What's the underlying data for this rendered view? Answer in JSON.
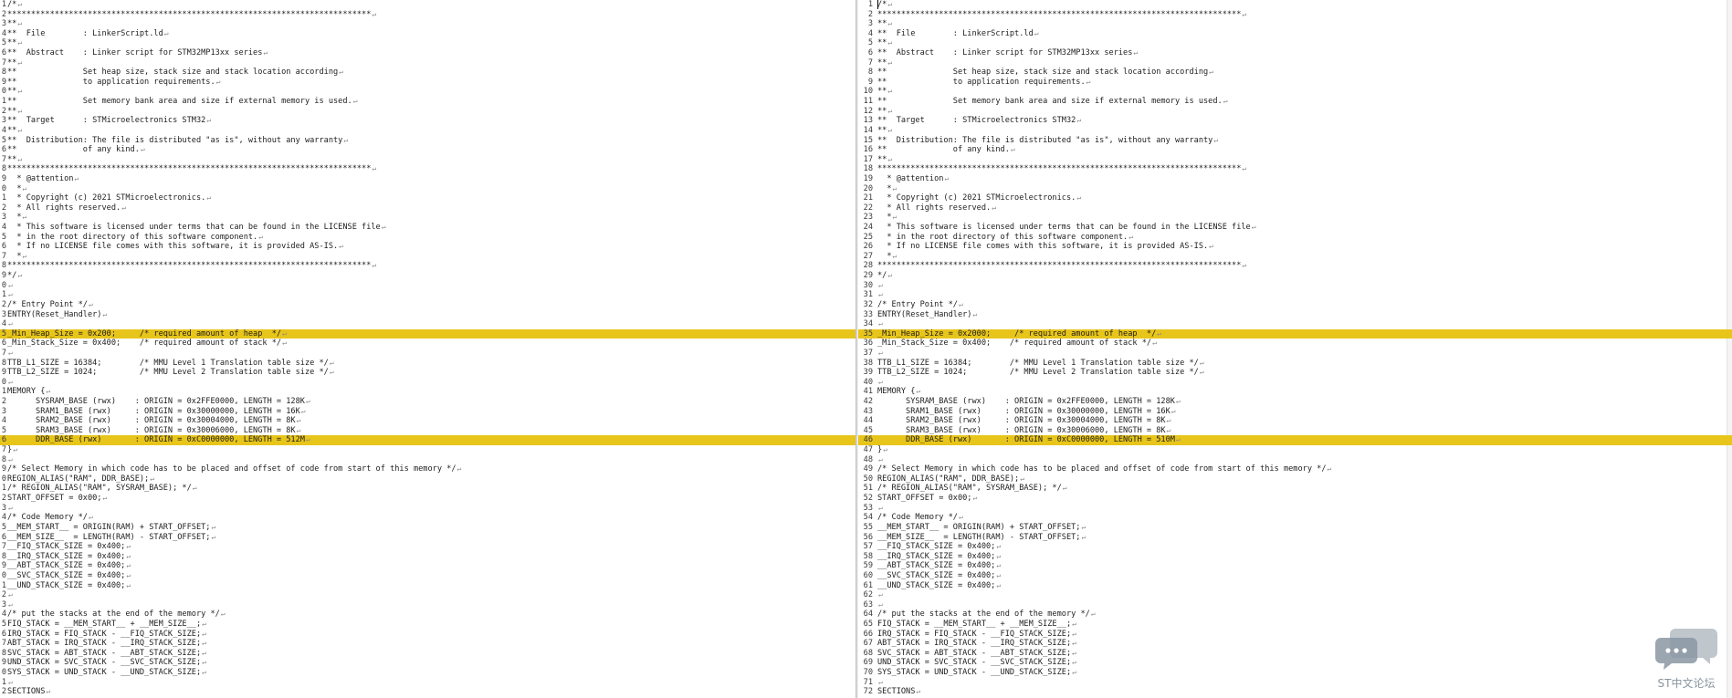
{
  "left_pane": {
    "line_numbers": [
      "1",
      "2",
      "3",
      "4",
      "5",
      "6",
      "7",
      "8",
      "9",
      "0",
      "1",
      "2",
      "3",
      "4",
      "5",
      "6",
      "7",
      "8",
      "9",
      "0",
      "1",
      "2",
      "3",
      "4",
      "5",
      "6",
      "7",
      "8",
      "9",
      "0",
      "1",
      "2",
      "3",
      "4",
      "5",
      "6",
      "7",
      "8",
      "9",
      "0",
      "1",
      "2",
      "3",
      "4",
      "5",
      "6",
      "7",
      "8",
      "9",
      "0",
      "1",
      "2",
      "3",
      "4",
      "5",
      "6",
      "7",
      "8",
      "9",
      "0",
      "1",
      "2",
      "3",
      "4",
      "5",
      "6",
      "7",
      "8",
      "9",
      "0",
      "1",
      "2"
    ],
    "lines": [
      "/*",
      "*****************************************************************************",
      "**",
      "**  File        : LinkerScript.ld",
      "**",
      "**  Abstract    : Linker script for STM32MP13xx series",
      "**",
      "**              Set heap size, stack size and stack location according",
      "**              to application requirements.",
      "**",
      "**              Set memory bank area and size if external memory is used.",
      "**",
      "**  Target      : STMicroelectronics STM32",
      "**",
      "**  Distribution: The file is distributed \"as is\", without any warranty",
      "**              of any kind.",
      "**",
      "*****************************************************************************",
      "  * @attention",
      "  *",
      "  * Copyright (c) 2021 STMicroelectronics.",
      "  * All rights reserved.",
      "  *",
      "  * This software is licensed under terms that can be found in the LICENSE file",
      "  * in the root directory of this software component.",
      "  * If no LICENSE file comes with this software, it is provided AS-IS.",
      "  *",
      "*****************************************************************************",
      "*/",
      "",
      "",
      "/* Entry Point */",
      "ENTRY(Reset_Handler)",
      "",
      "_Min_Heap_Size = 0x200;     /* required amount of heap  */",
      "_Min_Stack_Size = 0x400;    /* required amount of stack */",
      "",
      "TTB_L1_SIZE = 16384;        /* MMU Level 1 Translation table size */",
      "TTB_L2_SIZE = 1024;         /* MMU Level 2 Translation table size */",
      "",
      "MEMORY {",
      "      SYSRAM_BASE (rwx)    : ORIGIN = 0x2FFE0000, LENGTH = 128K",
      "      SRAM1_BASE (rwx)     : ORIGIN = 0x30000000, LENGTH = 16K",
      "      SRAM2_BASE (rwx)     : ORIGIN = 0x30004000, LENGTH = 8K",
      "      SRAM3_BASE (rwx)     : ORIGIN = 0x30006000, LENGTH = 8K",
      "      DDR_BASE (rwx)       : ORIGIN = 0xC0000000, LENGTH = 512M",
      "}",
      "",
      "/* Select Memory in which code has to be placed and offset of code from start of this memory */",
      "REGION_ALIAS(\"RAM\", DDR_BASE);",
      "/* REGION_ALIAS(\"RAM\", SYSRAM_BASE); */",
      "START_OFFSET = 0x00;",
      "",
      "/* Code Memory */",
      "__MEM_START__ = ORIGIN(RAM) + START_OFFSET;",
      "__MEM_SIZE__  = LENGTH(RAM) - START_OFFSET;",
      "__FIQ_STACK_SIZE = 0x400;",
      "__IRQ_STACK_SIZE = 0x400;",
      "__ABT_STACK_SIZE = 0x400;",
      "__SVC_STACK_SIZE = 0x400;",
      "__UND_STACK_SIZE = 0x400;",
      "",
      "",
      "/* put the stacks at the end of the memory */",
      "FIQ_STACK = __MEM_START__ + __MEM_SIZE__;",
      "IRQ_STACK = FIQ_STACK - __FIQ_STACK_SIZE;",
      "ABT_STACK = IRQ_STACK - __IRQ_STACK_SIZE;",
      "SVC_STACK = ABT_STACK - __ABT_STACK_SIZE;",
      "UND_STACK = SVC_STACK - __SVC_STACK_SIZE;",
      "SYS_STACK = UND_STACK - __UND_STACK_SIZE;",
      "",
      "SECTIONS"
    ],
    "highlighted_line_numbers": [
      "5",
      "6"
    ]
  },
  "right_pane": {
    "line_numbers": [
      "1",
      "2",
      "3",
      "4",
      "5",
      "6",
      "7",
      "8",
      "9",
      "10",
      "11",
      "12",
      "13",
      "14",
      "15",
      "16",
      "17",
      "18",
      "19",
      "20",
      "21",
      "22",
      "23",
      "24",
      "25",
      "26",
      "27",
      "28",
      "29",
      "30",
      "31",
      "32",
      "33",
      "34",
      "35",
      "36",
      "37",
      "38",
      "39",
      "40",
      "41",
      "42",
      "43",
      "44",
      "45",
      "46",
      "47",
      "48",
      "49",
      "50",
      "51",
      "52",
      "53",
      "54",
      "55",
      "56",
      "57",
      "58",
      "59",
      "60",
      "61",
      "62",
      "63",
      "64",
      "65",
      "66",
      "67",
      "68",
      "69",
      "70",
      "71",
      "72"
    ],
    "lines": [
      "/*",
      "*****************************************************************************",
      "**",
      "**  File        : LinkerScript.ld",
      "**",
      "**  Abstract    : Linker script for STM32MP13xx series",
      "**",
      "**              Set heap size, stack size and stack location according",
      "**              to application requirements.",
      "**",
      "**              Set memory bank area and size if external memory is used.",
      "**",
      "**  Target      : STMicroelectronics STM32",
      "**",
      "**  Distribution: The file is distributed \"as is\", without any warranty",
      "**              of any kind.",
      "**",
      "*****************************************************************************",
      "  * @attention",
      "  *",
      "  * Copyright (c) 2021 STMicroelectronics.",
      "  * All rights reserved.",
      "  *",
      "  * This software is licensed under terms that can be found in the LICENSE file",
      "  * in the root directory of this software component.",
      "  * If no LICENSE file comes with this software, it is provided AS-IS.",
      "  *",
      "*****************************************************************************",
      "*/",
      "",
      "",
      "/* Entry Point */",
      "ENTRY(Reset_Handler)",
      "",
      "_Min_Heap_Size = 0x2000;     /* required amount of heap  */",
      "_Min_Stack_Size = 0x400;    /* required amount of stack */",
      "",
      "TTB_L1_SIZE = 16384;        /* MMU Level 1 Translation table size */",
      "TTB_L2_SIZE = 1024;         /* MMU Level 2 Translation table size */",
      "",
      "MEMORY {",
      "      SYSRAM_BASE (rwx)    : ORIGIN = 0x2FFE0000, LENGTH = 128K",
      "      SRAM1_BASE (rwx)     : ORIGIN = 0x30000000, LENGTH = 16K",
      "      SRAM2_BASE (rwx)     : ORIGIN = 0x30004000, LENGTH = 8K",
      "      SRAM3_BASE (rwx)     : ORIGIN = 0x30006000, LENGTH = 8K",
      "      DDR_BASE (rwx)       : ORIGIN = 0xC0000000, LENGTH = 510M",
      "}",
      "",
      "/* Select Memory in which code has to be placed and offset of code from start of this memory */",
      "REGION_ALIAS(\"RAM\", DDR_BASE);",
      "/* REGION_ALIAS(\"RAM\", SYSRAM_BASE); */",
      "START_OFFSET = 0x00;",
      "",
      "/* Code Memory */",
      "__MEM_START__ = ORIGIN(RAM) + START_OFFSET;",
      "__MEM_SIZE__  = LENGTH(RAM) - START_OFFSET;",
      "__FIQ_STACK_SIZE = 0x400;",
      "__IRQ_STACK_SIZE = 0x400;",
      "__ABT_STACK_SIZE = 0x400;",
      "__SVC_STACK_SIZE = 0x400;",
      "__UND_STACK_SIZE = 0x400;",
      "",
      "",
      "/* put the stacks at the end of the memory */",
      "FIQ_STACK = __MEM_START__ + __MEM_SIZE__;",
      "IRQ_STACK = FIQ_STACK - __FIQ_STACK_SIZE;",
      "ABT_STACK = IRQ_STACK - __IRQ_STACK_SIZE;",
      "SVC_STACK = ABT_STACK - __ABT_STACK_SIZE;",
      "UND_STACK = SVC_STACK - __SVC_STACK_SIZE;",
      "SYS_STACK = UND_STACK - __UND_STACK_SIZE;",
      "",
      "SECTIONS"
    ],
    "highlighted_line_numbers": [
      "35",
      "46"
    ]
  },
  "eol_glyph": "↵",
  "watermark": {
    "text": "ST中文论坛",
    "color": "#8a97a3"
  },
  "colors": {
    "highlight": "#e8c51a"
  }
}
